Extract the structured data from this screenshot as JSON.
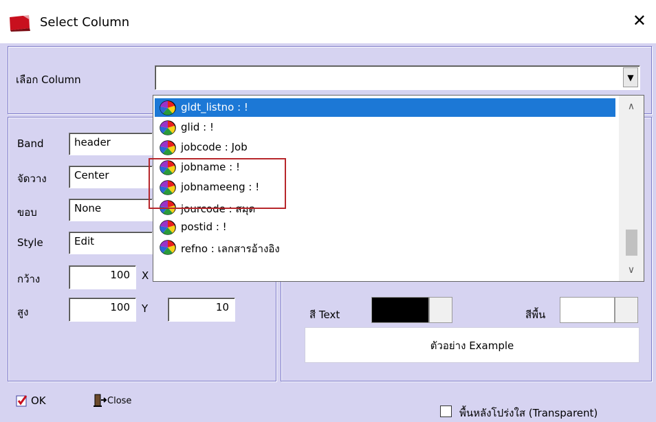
{
  "window": {
    "title": "Select Column",
    "close_glyph": "✕",
    "accent_color": "#1c78d6",
    "highlight_color": "#b7262a"
  },
  "column_select": {
    "label": "เลือก Column",
    "value": "",
    "dropdown_arrow": "▼"
  },
  "dropdown": {
    "items": [
      {
        "label": "gldt_listno : !",
        "selected": true
      },
      {
        "label": "glid : !"
      },
      {
        "label": "jobcode : Job"
      },
      {
        "label": "jobname : !"
      },
      {
        "label": "jobnameeng : !"
      },
      {
        "label": "jourcode : สมุด"
      },
      {
        "label": "postid : !"
      },
      {
        "label": "refno : เลกสารอ้างอิง"
      }
    ],
    "scroll_up": "∧",
    "scroll_down": "∨",
    "item_icon": "color-wheel-icon"
  },
  "props": {
    "band_label": "Band",
    "band_value": "header",
    "align_label": "จัดวาง",
    "align_value": "Center",
    "border_label": "ขอบ",
    "border_value": "None",
    "style_label": "Style",
    "style_value": "Edit",
    "width_label": "กว้าง",
    "width_value": "100",
    "x_label": "X",
    "height_label": "สูง",
    "height_value": "100",
    "y_label": "Y",
    "y_value": "10"
  },
  "colors": {
    "text_color_label": "สี Text",
    "text_color_value": "#000000",
    "bg_color_label": "สีพื้น",
    "bg_color_value": "#ffffff",
    "example_text": "ตัวอย่าง Example"
  },
  "buttons": {
    "ok_label": "OK",
    "close_label": "Close"
  },
  "transparent": {
    "label": "พื้นหลังโปร่งใส (Transparent)",
    "checked": false
  }
}
